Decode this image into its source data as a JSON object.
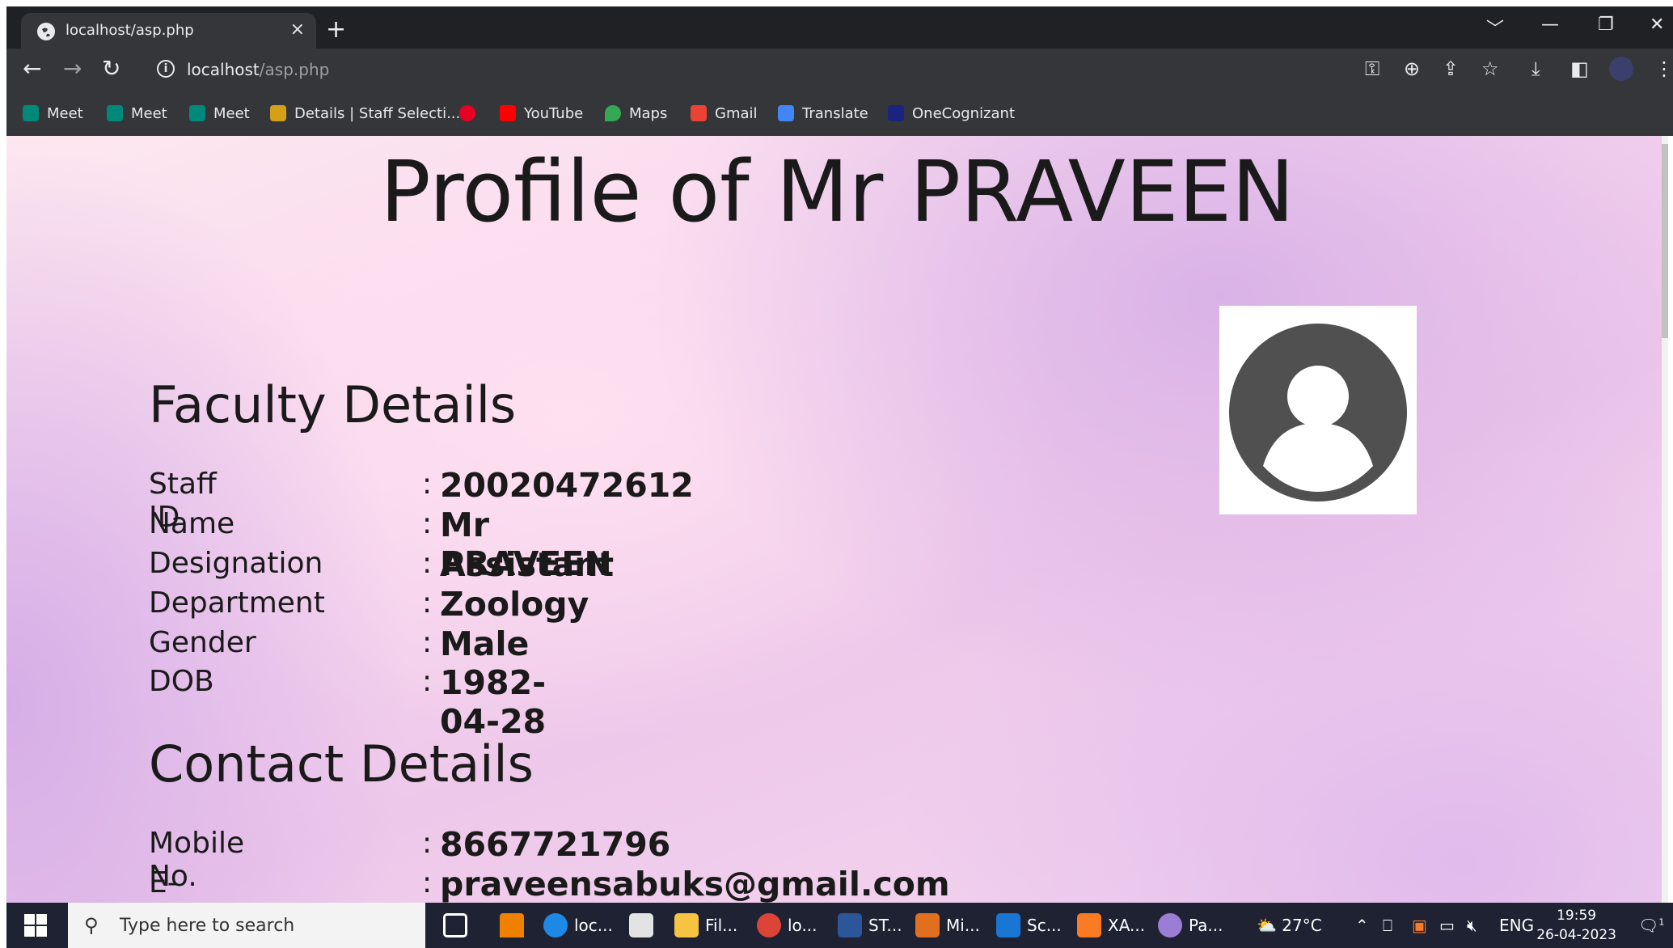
{
  "browser": {
    "tab_title": "localhost/asp.php",
    "tab_close": "×",
    "new_tab": "+",
    "url_host": "localhost",
    "url_path": "/asp.php",
    "window_controls": [
      "﹀",
      "—",
      "❐",
      "✕"
    ]
  },
  "bookmarks": [
    {
      "label": "Meet",
      "icon": "meet-icon",
      "color": "#00897b"
    },
    {
      "label": "Meet",
      "icon": "meet-icon",
      "color": "#00897b"
    },
    {
      "label": "Meet",
      "icon": "meet-icon",
      "color": "#00897b"
    },
    {
      "label": "Details | Staff Selecti...",
      "icon": "staff-selection-icon",
      "color": "#d4a017"
    },
    {
      "label": "",
      "icon": "pinterest-icon",
      "color": "#e60023"
    },
    {
      "label": "YouTube",
      "icon": "youtube-icon",
      "color": "#ff0000"
    },
    {
      "label": "Maps",
      "icon": "maps-icon",
      "color": "#34a853"
    },
    {
      "label": "Gmail",
      "icon": "gmail-icon",
      "color": "#ea4335"
    },
    {
      "label": "Translate",
      "icon": "translate-icon",
      "color": "#4285f4"
    },
    {
      "label": "OneCognizant",
      "icon": "onecognizant-icon",
      "color": "#1a237e"
    }
  ],
  "page": {
    "title": "Profile of Mr PRAVEEN",
    "faculty_heading": "Faculty Details",
    "faculty": [
      {
        "label": "Staff ID",
        "value": "20020472612"
      },
      {
        "label": "Name",
        "value": "Mr PRAVEEN"
      },
      {
        "label": "Designation",
        "value": "Assistant"
      },
      {
        "label": "Department",
        "value": "Zoology"
      },
      {
        "label": "Gender",
        "value": "Male"
      },
      {
        "label": "DOB",
        "value": "1982-04-28"
      }
    ],
    "contact_heading": "Contact Details",
    "contact": [
      {
        "label": "Mobile No.",
        "value": "8667721796"
      },
      {
        "label": "E-mail",
        "value": "praveensabuks@gmail.com"
      }
    ],
    "colon": ":"
  },
  "taskbar": {
    "search_placeholder": "Type here to search",
    "apps": [
      {
        "label": "",
        "icon": "task-view-icon"
      },
      {
        "label": "",
        "icon": "vlc-icon"
      },
      {
        "label": "loc...",
        "icon": "edge-icon"
      },
      {
        "label": "",
        "icon": "store-icon"
      },
      {
        "label": "Fil...",
        "icon": "file-explorer-icon"
      },
      {
        "label": "lo...",
        "icon": "chrome-icon"
      },
      {
        "label": "ST...",
        "icon": "word-icon"
      },
      {
        "label": "Mi...",
        "icon": "access-icon"
      },
      {
        "label": "Sc...",
        "icon": "photos-icon"
      },
      {
        "label": "XA...",
        "icon": "xampp-icon"
      },
      {
        "label": "Pa...",
        "icon": "paint-icon"
      }
    ],
    "weather": "27°C",
    "language": "ENG",
    "time": "19:59",
    "date": "26-04-2023",
    "notification_count": "1"
  }
}
